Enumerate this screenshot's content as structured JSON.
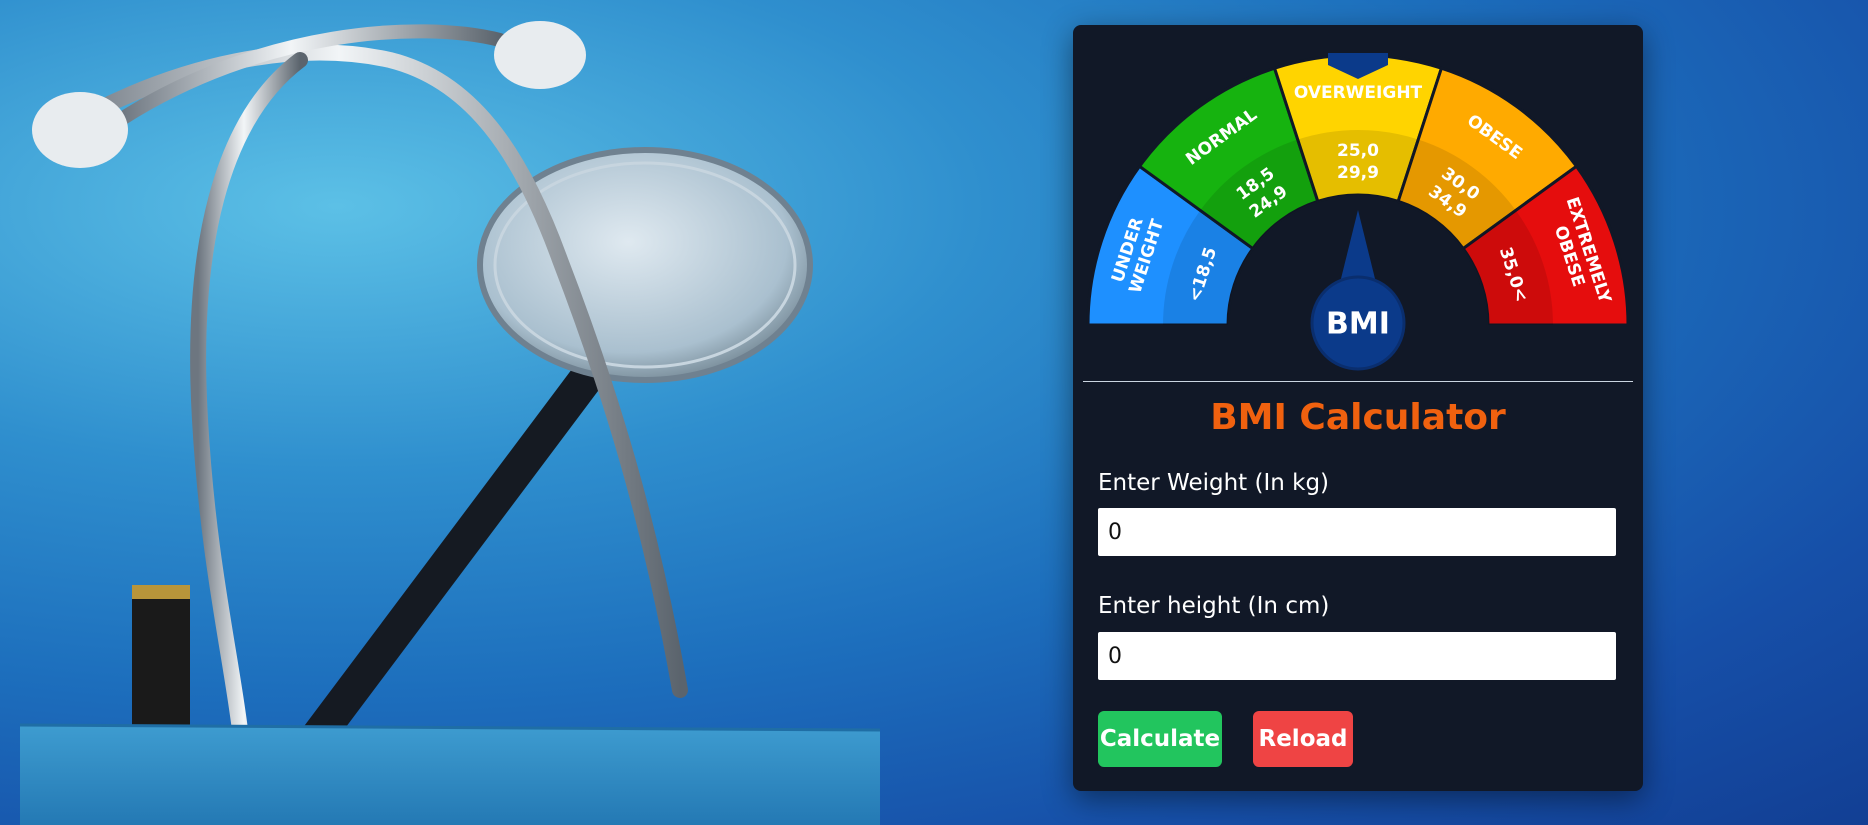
{
  "gauge": {
    "segments": [
      {
        "name": "UNDER",
        "name2": "WEIGHT",
        "range": "<18,5",
        "range2": "",
        "color": "#1e90ff"
      },
      {
        "name": "NORMAL",
        "name2": "",
        "range": "18,5",
        "range2": "24,9",
        "color": "#16b30f"
      },
      {
        "name": "OVERWEIGHT",
        "name2": "",
        "range": "25,0",
        "range2": "29,9",
        "color": "#ffd400"
      },
      {
        "name": "OBESE",
        "name2": "",
        "range": "30,0",
        "range2": "34,9",
        "color": "#ffaa00"
      },
      {
        "name": "EXTREMELY",
        "name2": "OBESE",
        "range": "35,0<",
        "range2": "",
        "color": "#e50d0d"
      }
    ],
    "needle_label": "BMI"
  },
  "calculator": {
    "title": "BMI Calculator",
    "weight_label": "Enter Weight (In kg)",
    "weight_value": "0",
    "height_label": "Enter height (In cm)",
    "height_value": "0",
    "calculate_label": "Calculate",
    "reload_label": "Reload"
  },
  "colors": {
    "title": "#f0610f",
    "calculate": "#22c55e",
    "reload": "#ef4444",
    "card": "#111827"
  }
}
